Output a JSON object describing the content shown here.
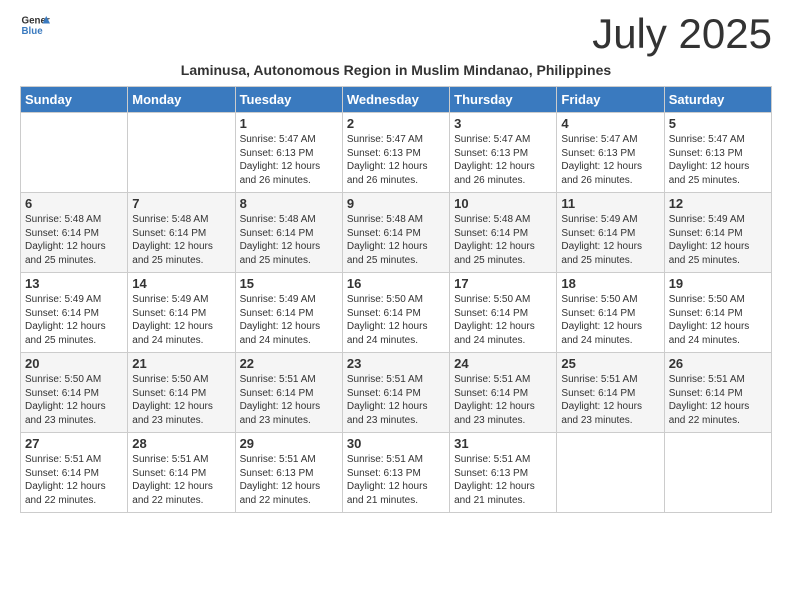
{
  "logo": {
    "general": "General",
    "blue": "Blue"
  },
  "title": "July 2025",
  "subtitle": "Laminusa, Autonomous Region in Muslim Mindanao, Philippines",
  "days_of_week": [
    "Sunday",
    "Monday",
    "Tuesday",
    "Wednesday",
    "Thursday",
    "Friday",
    "Saturday"
  ],
  "weeks": [
    {
      "shaded": false,
      "days": [
        {
          "number": "",
          "info": ""
        },
        {
          "number": "",
          "info": ""
        },
        {
          "number": "1",
          "info": "Sunrise: 5:47 AM\nSunset: 6:13 PM\nDaylight: 12 hours and 26 minutes."
        },
        {
          "number": "2",
          "info": "Sunrise: 5:47 AM\nSunset: 6:13 PM\nDaylight: 12 hours and 26 minutes."
        },
        {
          "number": "3",
          "info": "Sunrise: 5:47 AM\nSunset: 6:13 PM\nDaylight: 12 hours and 26 minutes."
        },
        {
          "number": "4",
          "info": "Sunrise: 5:47 AM\nSunset: 6:13 PM\nDaylight: 12 hours and 26 minutes."
        },
        {
          "number": "5",
          "info": "Sunrise: 5:47 AM\nSunset: 6:13 PM\nDaylight: 12 hours and 25 minutes."
        }
      ]
    },
    {
      "shaded": true,
      "days": [
        {
          "number": "6",
          "info": "Sunrise: 5:48 AM\nSunset: 6:14 PM\nDaylight: 12 hours and 25 minutes."
        },
        {
          "number": "7",
          "info": "Sunrise: 5:48 AM\nSunset: 6:14 PM\nDaylight: 12 hours and 25 minutes."
        },
        {
          "number": "8",
          "info": "Sunrise: 5:48 AM\nSunset: 6:14 PM\nDaylight: 12 hours and 25 minutes."
        },
        {
          "number": "9",
          "info": "Sunrise: 5:48 AM\nSunset: 6:14 PM\nDaylight: 12 hours and 25 minutes."
        },
        {
          "number": "10",
          "info": "Sunrise: 5:48 AM\nSunset: 6:14 PM\nDaylight: 12 hours and 25 minutes."
        },
        {
          "number": "11",
          "info": "Sunrise: 5:49 AM\nSunset: 6:14 PM\nDaylight: 12 hours and 25 minutes."
        },
        {
          "number": "12",
          "info": "Sunrise: 5:49 AM\nSunset: 6:14 PM\nDaylight: 12 hours and 25 minutes."
        }
      ]
    },
    {
      "shaded": false,
      "days": [
        {
          "number": "13",
          "info": "Sunrise: 5:49 AM\nSunset: 6:14 PM\nDaylight: 12 hours and 25 minutes."
        },
        {
          "number": "14",
          "info": "Sunrise: 5:49 AM\nSunset: 6:14 PM\nDaylight: 12 hours and 24 minutes."
        },
        {
          "number": "15",
          "info": "Sunrise: 5:49 AM\nSunset: 6:14 PM\nDaylight: 12 hours and 24 minutes."
        },
        {
          "number": "16",
          "info": "Sunrise: 5:50 AM\nSunset: 6:14 PM\nDaylight: 12 hours and 24 minutes."
        },
        {
          "number": "17",
          "info": "Sunrise: 5:50 AM\nSunset: 6:14 PM\nDaylight: 12 hours and 24 minutes."
        },
        {
          "number": "18",
          "info": "Sunrise: 5:50 AM\nSunset: 6:14 PM\nDaylight: 12 hours and 24 minutes."
        },
        {
          "number": "19",
          "info": "Sunrise: 5:50 AM\nSunset: 6:14 PM\nDaylight: 12 hours and 24 minutes."
        }
      ]
    },
    {
      "shaded": true,
      "days": [
        {
          "number": "20",
          "info": "Sunrise: 5:50 AM\nSunset: 6:14 PM\nDaylight: 12 hours and 23 minutes."
        },
        {
          "number": "21",
          "info": "Sunrise: 5:50 AM\nSunset: 6:14 PM\nDaylight: 12 hours and 23 minutes."
        },
        {
          "number": "22",
          "info": "Sunrise: 5:51 AM\nSunset: 6:14 PM\nDaylight: 12 hours and 23 minutes."
        },
        {
          "number": "23",
          "info": "Sunrise: 5:51 AM\nSunset: 6:14 PM\nDaylight: 12 hours and 23 minutes."
        },
        {
          "number": "24",
          "info": "Sunrise: 5:51 AM\nSunset: 6:14 PM\nDaylight: 12 hours and 23 minutes."
        },
        {
          "number": "25",
          "info": "Sunrise: 5:51 AM\nSunset: 6:14 PM\nDaylight: 12 hours and 23 minutes."
        },
        {
          "number": "26",
          "info": "Sunrise: 5:51 AM\nSunset: 6:14 PM\nDaylight: 12 hours and 22 minutes."
        }
      ]
    },
    {
      "shaded": false,
      "days": [
        {
          "number": "27",
          "info": "Sunrise: 5:51 AM\nSunset: 6:14 PM\nDaylight: 12 hours and 22 minutes."
        },
        {
          "number": "28",
          "info": "Sunrise: 5:51 AM\nSunset: 6:14 PM\nDaylight: 12 hours and 22 minutes."
        },
        {
          "number": "29",
          "info": "Sunrise: 5:51 AM\nSunset: 6:13 PM\nDaylight: 12 hours and 22 minutes."
        },
        {
          "number": "30",
          "info": "Sunrise: 5:51 AM\nSunset: 6:13 PM\nDaylight: 12 hours and 21 minutes."
        },
        {
          "number": "31",
          "info": "Sunrise: 5:51 AM\nSunset: 6:13 PM\nDaylight: 12 hours and 21 minutes."
        },
        {
          "number": "",
          "info": ""
        },
        {
          "number": "",
          "info": ""
        }
      ]
    }
  ]
}
